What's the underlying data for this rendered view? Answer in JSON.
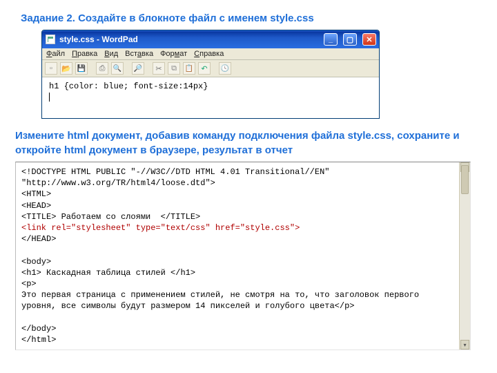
{
  "heading": "Задание 2. Создайте в блокноте файл с именем style.css",
  "wordpad": {
    "title": "style.css - WordPad",
    "menu": {
      "file": "Файл",
      "edit": "Правка",
      "view": "Вид",
      "insert": "Вставка",
      "format": "Формат",
      "help": "Справка"
    },
    "content": "h1 {color: blue; font-size:14px}"
  },
  "subheading": "Измените html документ, добавив команду подключения файла style.css, сохраните и откройте html документ в браузере, результат в отчет",
  "code": {
    "line1": "<!DOCTYPE HTML PUBLIC \"-//W3C//DTD HTML 4.01 Transitional//EN\"",
    "line2": "\"http://www.w3.org/TR/html4/loose.dtd\">",
    "line3": "<HTML>",
    "line4": "<HEAD>",
    "line5": "<TITLE> Работаем со слоями  </TITLE>",
    "line6_red": "<link rel=\"stylesheet\" type=\"text/css\" href=\"style.css\">",
    "line7": "</HEAD>",
    "line8": "",
    "line9": "<body>",
    "line10": "<h1> Каскадная таблица стилей </h1>",
    "line11": "<p>",
    "line12": "Это первая страница с применением стилей, не смотря на то, что заголовок первого уровня, все символы будут размером 14 пикселей и голубого цвета</p>",
    "line13": "",
    "line14": "</body>",
    "line15": "</html>"
  }
}
